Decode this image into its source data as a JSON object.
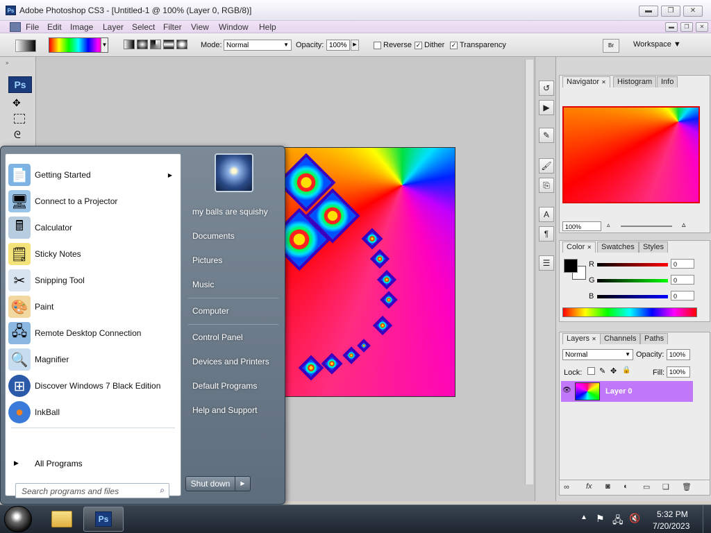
{
  "window": {
    "title": "Adobe Photoshop CS3 - [Untitled-1 @ 100% (Layer 0, RGB/8)]",
    "app_badge": "Ps",
    "minimize": "▬",
    "restore": "❐",
    "close": "✕",
    "doc_minimize": "▬",
    "doc_restore": "❐",
    "doc_close": "✕"
  },
  "menu": [
    "File",
    "Edit",
    "Image",
    "Layer",
    "Select",
    "Filter",
    "View",
    "Window",
    "Help"
  ],
  "options": {
    "mode_label": "Mode:",
    "mode_value": "Normal",
    "opacity_label": "Opacity:",
    "opacity_value": "100%",
    "reverse": "Reverse",
    "dither": "Dither",
    "transparency": "Transparency",
    "workspace": "Workspace ▼",
    "br_badge": "Br"
  },
  "toolbox": {
    "badge": "Ps"
  },
  "navigator": {
    "tabs": [
      "Navigator",
      "Histogram",
      "Info"
    ],
    "zoom": "100%"
  },
  "color": {
    "tabs": [
      "Color",
      "Swatches",
      "Styles"
    ],
    "r_label": "R",
    "g_label": "G",
    "b_label": "B",
    "r_value": "0",
    "g_value": "0",
    "b_value": "0"
  },
  "layers": {
    "tabs": [
      "Layers",
      "Channels",
      "Paths"
    ],
    "blend": "Normal",
    "opacity_label": "Opacity:",
    "opacity_value": "100%",
    "lock_label": "Lock:",
    "fill_label": "Fill:",
    "fill_value": "100%",
    "layer_name": "Layer 0"
  },
  "startmenu": {
    "programs": [
      {
        "label": "Getting Started",
        "icon": "getting-started-icon",
        "glyph": "📄",
        "color": "#7fb2e0"
      },
      {
        "label": "Connect to a Projector",
        "icon": "projector-icon",
        "glyph": "🖥",
        "color": "#9ac4e8"
      },
      {
        "label": "Calculator",
        "icon": "calculator-icon",
        "glyph": "🖩",
        "color": "#b8cce0"
      },
      {
        "label": "Sticky Notes",
        "icon": "sticky-notes-icon",
        "glyph": "🗒",
        "color": "#f4e27a"
      },
      {
        "label": "Snipping Tool",
        "icon": "snipping-tool-icon",
        "glyph": "✂",
        "color": "#d8e4f0"
      },
      {
        "label": "Paint",
        "icon": "paint-icon",
        "glyph": "🎨",
        "color": "#f0d8a0"
      },
      {
        "label": "Remote Desktop Connection",
        "icon": "remote-desktop-icon",
        "glyph": "🖧",
        "color": "#8ab8e0"
      },
      {
        "label": "Magnifier",
        "icon": "magnifier-icon",
        "glyph": "🔍",
        "color": "#c8dcf0"
      },
      {
        "label": "Discover Windows 7 Black Edition",
        "icon": "windows-orb-icon",
        "glyph": "⊞",
        "color": "#2a5aa8"
      },
      {
        "label": "InkBall",
        "icon": "inkball-icon",
        "glyph": "●",
        "color": "#3a7ad8"
      }
    ],
    "all_programs": "All Programs",
    "search_placeholder": "Search programs and files",
    "user": "my balls are squishy",
    "links": [
      "Documents",
      "Pictures",
      "Music",
      "Computer",
      "Control Panel",
      "Devices and Printers",
      "Default Programs",
      "Help and Support"
    ],
    "shutdown": "Shut down"
  },
  "taskbar": {
    "time": "5:32 PM",
    "date": "7/20/2023",
    "ps_badge": "Ps"
  }
}
